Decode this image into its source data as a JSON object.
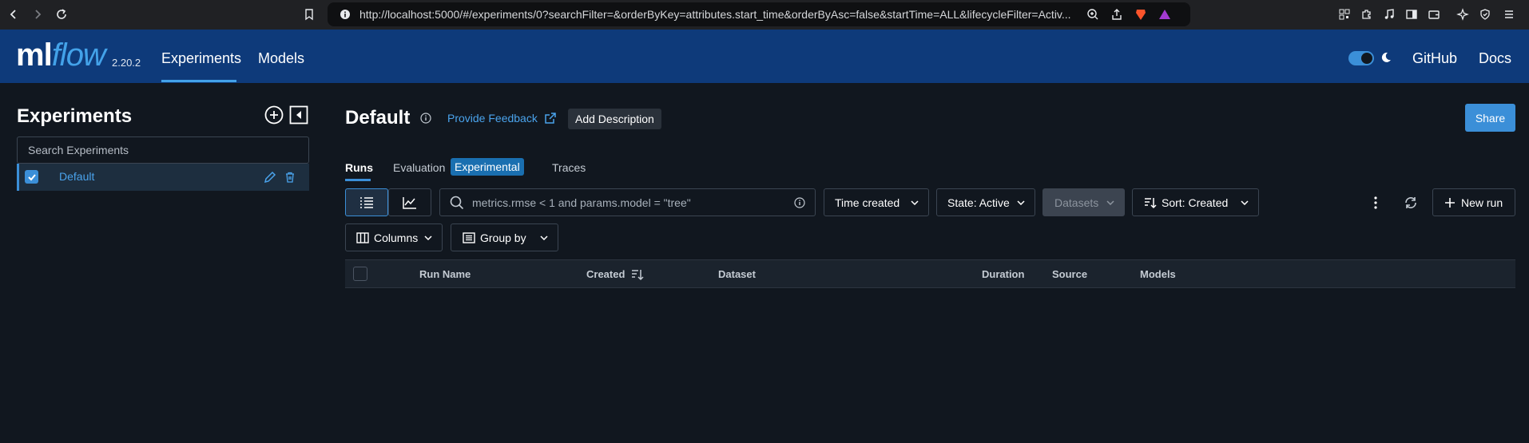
{
  "browser": {
    "url": "http://localhost:5000/#/experiments/0?searchFilter=&orderByKey=attributes.start_time&orderByAsc=false&startTime=ALL&lifecycleFilter=Activ..."
  },
  "header": {
    "logo_ml": "ml",
    "logo_flow": "flow",
    "version": "2.20.2",
    "nav": [
      "Experiments",
      "Models"
    ],
    "github": "GitHub",
    "docs": "Docs"
  },
  "sidebar": {
    "title": "Experiments",
    "search_placeholder": "Search Experiments",
    "experiments": [
      {
        "name": "Default"
      }
    ]
  },
  "main": {
    "title": "Default",
    "feedback": "Provide Feedback",
    "add_description": "Add Description",
    "share": "Share",
    "tabs": {
      "runs": "Runs",
      "evaluation": "Evaluation",
      "evaluation_badge": "Experimental",
      "traces": "Traces"
    },
    "search_placeholder": "metrics.rmse < 1 and params.model = \"tree\"",
    "time_created": "Time created",
    "state": "State: Active",
    "datasets": "Datasets",
    "sort": "Sort: Created",
    "new_run": "New run",
    "columns": "Columns",
    "group_by": "Group by",
    "table_headers": [
      "Run Name",
      "Created",
      "Dataset",
      "Duration",
      "Source",
      "Models"
    ]
  },
  "colors": {
    "header_bg": "#0e3a7a",
    "page_bg": "#11171f",
    "accent": "#3b8fd8",
    "link": "#4aa3ec"
  }
}
